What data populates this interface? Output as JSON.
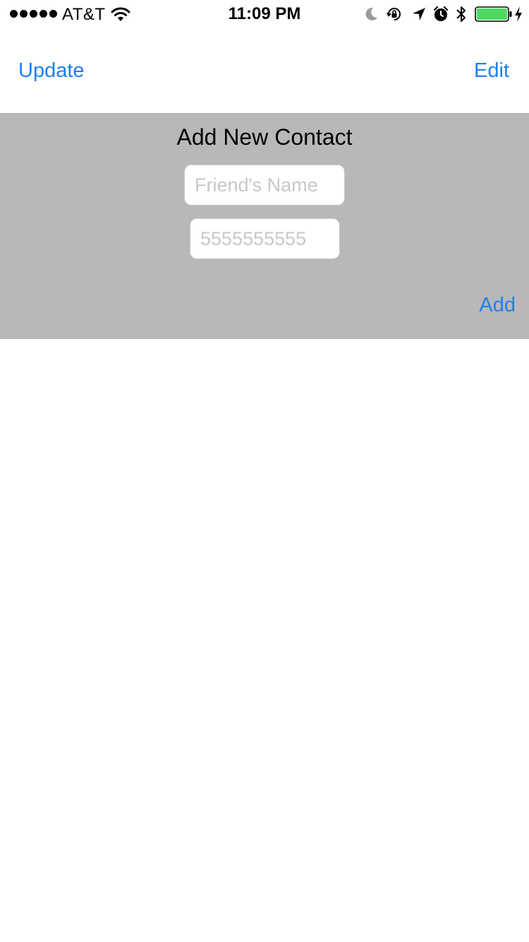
{
  "status_bar": {
    "carrier": "AT&T",
    "time": "11:09 PM",
    "signal_bars": 5,
    "battery_level": 1.0,
    "battery_color": "#4cd964",
    "icons": [
      "signal-icon",
      "wifi-icon",
      "moon-icon",
      "rotation-lock-icon",
      "location-icon",
      "alarm-icon",
      "bluetooth-icon",
      "battery-icon",
      "charging-icon"
    ]
  },
  "nav": {
    "left_label": "Update",
    "right_label": "Edit",
    "accent_color": "#1e7ff0"
  },
  "add_contact": {
    "title": "Add New Contact",
    "name_placeholder": "Friend's Name",
    "phone_placeholder": "5555555555",
    "name_value": "",
    "phone_value": "",
    "add_label": "Add",
    "panel_color": "#b8b8b8"
  }
}
